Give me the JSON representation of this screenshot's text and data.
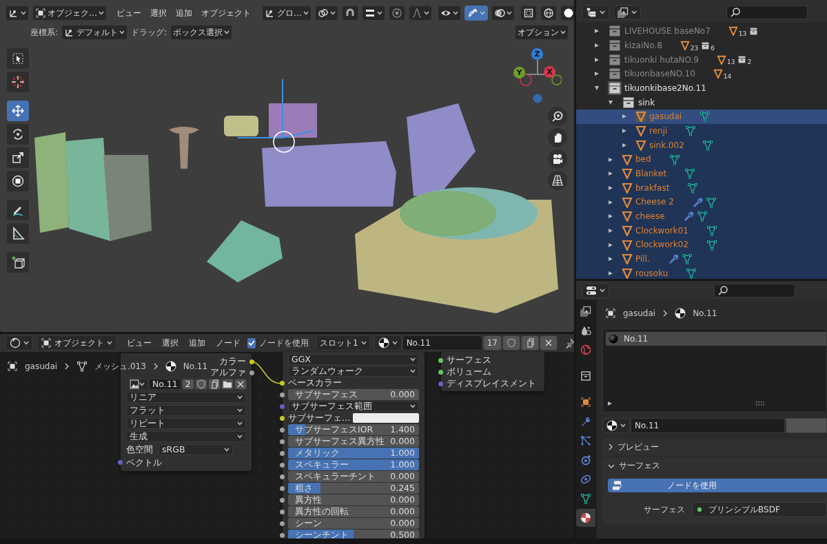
{
  "viewport": {
    "header": {
      "mode": "オブジェク…",
      "menus": [
        "ビュー",
        "選択",
        "追加",
        "オブジェクト"
      ],
      "orientation": "グロ…",
      "toggles": [
        {
          "kind": "pivot",
          "on": false
        },
        {
          "kind": "magnet",
          "on": false
        },
        {
          "kind": "snap",
          "on": false
        },
        {
          "kind": "proportional",
          "on": false
        },
        {
          "kind": "falloff",
          "on": false
        },
        {
          "kind": "visibility",
          "on": false
        },
        {
          "kind": "gizmo",
          "on": true
        },
        {
          "kind": "overlay",
          "on": false
        },
        {
          "kind": "xray",
          "on": false
        },
        {
          "kind": "wireframe",
          "on": false
        },
        {
          "kind": "solid",
          "on": false
        }
      ]
    },
    "tool_settings": {
      "coord_label": "座標系:",
      "coord_value": "デフォルト",
      "drag_label": "ドラッグ:",
      "drag_value": "ボックス選択",
      "options": "オプション"
    },
    "tools": [
      {
        "kind": "select",
        "selected": false
      },
      {
        "kind": "cursor",
        "selected": false
      },
      {
        "kind": "move",
        "selected": true
      },
      {
        "kind": "rotate",
        "selected": false
      },
      {
        "kind": "scale",
        "selected": false
      },
      {
        "kind": "transform",
        "selected": false
      },
      {
        "kind": "annotate",
        "selected": false
      },
      {
        "kind": "measure",
        "selected": false
      },
      {
        "kind": "add_cube",
        "selected": false
      }
    ],
    "gizmo": [
      {
        "label": "Z",
        "color": "#2f7fd8"
      },
      {
        "label": "Y",
        "color": "#6ea028"
      },
      {
        "label": "X",
        "color": "#d8344c"
      }
    ],
    "nav": [
      {
        "kind": "zoom"
      },
      {
        "kind": "hand"
      },
      {
        "kind": "camera"
      },
      {
        "kind": "grid"
      }
    ]
  },
  "outliner": {
    "items": [
      {
        "kind": "collection",
        "name": "LIVEHOUSE baseNo7",
        "expanded": false,
        "excluded": true,
        "selected": false,
        "active": false,
        "badges": [
          {
            "kind": "mesh",
            "count": "13"
          },
          {
            "kind": "collection"
          }
        ]
      },
      {
        "kind": "collection",
        "name": "kizaiNo.8",
        "expanded": false,
        "excluded": true,
        "selected": false,
        "active": false,
        "badges": [
          {
            "kind": "mesh",
            "count": "23"
          },
          {
            "kind": "collection",
            "count": "6"
          }
        ]
      },
      {
        "kind": "collection",
        "name": "tikuonki hutaNO.9",
        "expanded": false,
        "excluded": true,
        "selected": false,
        "active": false,
        "badges": [
          {
            "kind": "mesh",
            "count": "13"
          },
          {
            "kind": "collection",
            "count": "2"
          }
        ]
      },
      {
        "kind": "collection",
        "name": "tikuonbaseNO.10",
        "expanded": false,
        "excluded": true,
        "selected": false,
        "active": false,
        "badges": [
          {
            "kind": "mesh",
            "count": "14"
          }
        ]
      },
      {
        "kind": "collection",
        "name": "tikuonkibase2No.11",
        "expanded": true,
        "excluded": false,
        "selected": false,
        "active": true,
        "children": [
          {
            "kind": "collection",
            "name": "sink",
            "expanded": true,
            "excluded": false,
            "selected": false,
            "active": false,
            "children": [
              {
                "kind": "mesh",
                "name": "gasudai",
                "expanded": false,
                "selected": true,
                "active": true,
                "modifier": false
              },
              {
                "kind": "mesh",
                "name": "renji",
                "expanded": false,
                "selected": true,
                "active": false,
                "modifier": false
              },
              {
                "kind": "mesh",
                "name": "sink.002",
                "expanded": false,
                "selected": true,
                "active": false,
                "modifier": false
              }
            ]
          },
          {
            "kind": "mesh",
            "name": "bed",
            "expanded": false,
            "selected": true,
            "active": false,
            "modifier": false
          },
          {
            "kind": "mesh",
            "name": "Blanket",
            "expanded": false,
            "selected": true,
            "active": false,
            "modifier": false
          },
          {
            "kind": "mesh",
            "name": "brakfast",
            "expanded": false,
            "selected": true,
            "active": false,
            "modifier": false
          },
          {
            "kind": "mesh",
            "name": "Cheese 2",
            "expanded": false,
            "selected": true,
            "active": false,
            "modifier": true
          },
          {
            "kind": "mesh",
            "name": "cheese",
            "expanded": false,
            "selected": true,
            "active": false,
            "modifier": true
          },
          {
            "kind": "mesh",
            "name": "Clockwork01",
            "expanded": false,
            "selected": true,
            "active": false,
            "modifier": false
          },
          {
            "kind": "mesh",
            "name": "Clockwork02",
            "expanded": false,
            "selected": true,
            "active": false,
            "modifier": false
          },
          {
            "kind": "mesh",
            "name": "Pill.",
            "expanded": false,
            "selected": true,
            "active": false,
            "modifier": true
          },
          {
            "kind": "mesh",
            "name": "rousoku",
            "expanded": false,
            "selected": true,
            "active": false,
            "modifier": false
          }
        ]
      }
    ]
  },
  "node_editor": {
    "header": {
      "mode": "オブジェクト",
      "menus": [
        "ビュー",
        "選択",
        "追加",
        "ノード"
      ],
      "use_nodes": {
        "label": "ノードを使用",
        "checked": true
      },
      "slot": "スロット1",
      "material": "No.11",
      "users": "17"
    },
    "breadcrumb": [
      {
        "kind": "object",
        "label": "gasudai"
      },
      {
        "kind": "mesh",
        "label": "メッシュ.013"
      },
      {
        "kind": "material",
        "label": "No.11"
      }
    ],
    "image_node": {
      "outputs": [
        {
          "label": "カラー",
          "color": "#c7c729"
        },
        {
          "label": "アルファ",
          "color": "#a1a1a1"
        }
      ],
      "image": "No.11",
      "users": "2",
      "dropdowns": [
        "リニア",
        "フラット",
        "リピート",
        "生成"
      ],
      "color_space_label": "色空間",
      "color_space": "sRGB",
      "inputs": [
        {
          "label": "ベクトル",
          "color": "#6363c7"
        }
      ]
    },
    "principled_node": {
      "dropdowns": [
        "GGX",
        "ランダムウォーク"
      ],
      "inputs": [
        {
          "kind": "socket",
          "label": "ベースカラー",
          "color": "#c7c729"
        },
        {
          "kind": "slider",
          "label": "サブサーフェス",
          "value": "0.000",
          "level": 0,
          "color": "#a1a1a1"
        },
        {
          "kind": "dropdown",
          "label": "サブサーフェス範囲",
          "color": "#6363c7"
        },
        {
          "kind": "color",
          "label": "サブサーフェ…",
          "color": "#c7c729"
        },
        {
          "kind": "slider",
          "label": "サブサーフェスIOR",
          "value": "1.400",
          "level": 0.13,
          "color": "#a1a1a1"
        },
        {
          "kind": "slider",
          "label": "サブサーフェス異方性",
          "value": "0.000",
          "level": 0,
          "color": "#a1a1a1"
        },
        {
          "kind": "slider",
          "label": "メタリック",
          "value": "1.000",
          "level": 1,
          "color": "#a1a1a1"
        },
        {
          "kind": "slider",
          "label": "スペキュラー",
          "value": "1.000",
          "level": 1,
          "color": "#a1a1a1"
        },
        {
          "kind": "slider",
          "label": "スペキュラーチント",
          "value": "0.000",
          "level": 0,
          "color": "#a1a1a1"
        },
        {
          "kind": "slider",
          "label": "粗さ",
          "value": "0.245",
          "level": 0.245,
          "color": "#a1a1a1"
        },
        {
          "kind": "slider",
          "label": "異方性",
          "value": "0.000",
          "level": 0,
          "color": "#a1a1a1"
        },
        {
          "kind": "slider",
          "label": "異方性の回転",
          "value": "0.000",
          "level": 0,
          "color": "#a1a1a1"
        },
        {
          "kind": "slider",
          "label": "シーン",
          "value": "0.000",
          "level": 0,
          "color": "#a1a1a1"
        },
        {
          "kind": "slider",
          "label": "シーンチント",
          "value": "0.500",
          "level": 0.5,
          "color": "#a1a1a1"
        }
      ]
    },
    "output_node": {
      "inputs": [
        {
          "label": "サーフェス",
          "color": "#63c763"
        },
        {
          "label": "ボリューム",
          "color": "#63c763"
        },
        {
          "label": "ディスプレイスメント",
          "color": "#6363c7"
        }
      ]
    }
  },
  "properties": {
    "tabs": [
      {
        "kind": "output",
        "selected": false
      },
      {
        "kind": "view_layer",
        "selected": false
      },
      {
        "kind": "world",
        "selected": false
      },
      {
        "kind": "collection",
        "selected": false
      },
      {
        "kind": "object",
        "selected": false
      },
      {
        "kind": "modifiers",
        "selected": false
      },
      {
        "kind": "particles",
        "selected": false
      },
      {
        "kind": "physics",
        "selected": false
      },
      {
        "kind": "constraints",
        "selected": false
      },
      {
        "kind": "data",
        "selected": false
      },
      {
        "kind": "material",
        "selected": true
      }
    ],
    "breadcrumb": [
      {
        "kind": "object",
        "label": "gasudai"
      },
      {
        "kind": "material",
        "label": "No.11"
      }
    ],
    "slots": [
      {
        "label": "No.11",
        "selected": true
      }
    ],
    "material": "No.11",
    "panels": [
      {
        "label": "プレビュー",
        "expanded": false
      },
      {
        "label": "サーフェス",
        "expanded": true
      }
    ],
    "use_nodes_button": "ノードを使用",
    "surface_label": "サーフェス",
    "surface_value": "プリンシプルBSDF"
  }
}
